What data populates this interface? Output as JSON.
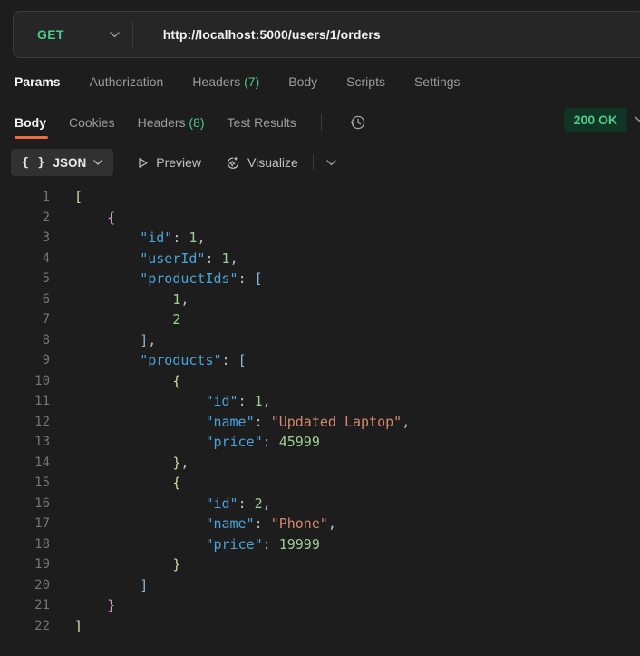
{
  "request": {
    "method": "GET",
    "url": "http://localhost:5000/users/1/orders"
  },
  "request_tabs": {
    "items": [
      {
        "label": "Params",
        "active": true
      },
      {
        "label": "Authorization"
      },
      {
        "label": "Headers",
        "count": "(7)"
      },
      {
        "label": "Body"
      },
      {
        "label": "Scripts"
      },
      {
        "label": "Settings"
      }
    ]
  },
  "response_tabs": {
    "items": [
      {
        "label": "Body",
        "active": true
      },
      {
        "label": "Cookies"
      },
      {
        "label": "Headers",
        "count": "(8)"
      },
      {
        "label": "Test Results"
      }
    ]
  },
  "status": {
    "text": "200 OK"
  },
  "toolbar": {
    "format_label": "JSON",
    "braces_glyph": "{ }",
    "preview_label": "Preview",
    "visualize_label": "Visualize"
  },
  "icons": [
    "chevron-down-icon",
    "history-clock-icon",
    "play-icon",
    "sparkle-visualize-icon",
    "braces-icon"
  ],
  "colors": {
    "accent_green": "#4dc98a",
    "tab_active_underline": "#ee6b3b",
    "status_badge_bg": "#113524",
    "key_blue": "#4aa3d9",
    "number_green": "#9ccf93",
    "string_orange": "#d8876b"
  },
  "response_body": {
    "line_count": 22,
    "lines": [
      {
        "n": 1,
        "indent": 0,
        "tokens": [
          [
            "b1",
            "["
          ]
        ]
      },
      {
        "n": 2,
        "indent": 1,
        "tokens": [
          [
            "b2",
            "{"
          ]
        ]
      },
      {
        "n": 3,
        "indent": 2,
        "tokens": [
          [
            "key",
            "\"id\""
          ],
          [
            "pun",
            ": "
          ],
          [
            "num",
            "1"
          ],
          [
            "pun",
            ","
          ]
        ]
      },
      {
        "n": 4,
        "indent": 2,
        "tokens": [
          [
            "key",
            "\"userId\""
          ],
          [
            "pun",
            ": "
          ],
          [
            "num",
            "1"
          ],
          [
            "pun",
            ","
          ]
        ]
      },
      {
        "n": 5,
        "indent": 2,
        "tokens": [
          [
            "key",
            "\"productIds\""
          ],
          [
            "pun",
            ": "
          ],
          [
            "b3",
            "["
          ]
        ]
      },
      {
        "n": 6,
        "indent": 3,
        "tokens": [
          [
            "num",
            "1"
          ],
          [
            "pun",
            ","
          ]
        ]
      },
      {
        "n": 7,
        "indent": 3,
        "tokens": [
          [
            "num",
            "2"
          ]
        ]
      },
      {
        "n": 8,
        "indent": 2,
        "tokens": [
          [
            "b3",
            "]"
          ],
          [
            "pun",
            ","
          ]
        ]
      },
      {
        "n": 9,
        "indent": 2,
        "tokens": [
          [
            "key",
            "\"products\""
          ],
          [
            "pun",
            ": "
          ],
          [
            "b3",
            "["
          ]
        ]
      },
      {
        "n": 10,
        "indent": 3,
        "tokens": [
          [
            "b4",
            "{"
          ]
        ]
      },
      {
        "n": 11,
        "indent": 4,
        "tokens": [
          [
            "key",
            "\"id\""
          ],
          [
            "pun",
            ": "
          ],
          [
            "num",
            "1"
          ],
          [
            "pun",
            ","
          ]
        ]
      },
      {
        "n": 12,
        "indent": 4,
        "tokens": [
          [
            "key",
            "\"name\""
          ],
          [
            "pun",
            ": "
          ],
          [
            "str",
            "\"Updated Laptop\""
          ],
          [
            "pun",
            ","
          ]
        ]
      },
      {
        "n": 13,
        "indent": 4,
        "tokens": [
          [
            "key",
            "\"price\""
          ],
          [
            "pun",
            ": "
          ],
          [
            "num",
            "45999"
          ]
        ]
      },
      {
        "n": 14,
        "indent": 3,
        "tokens": [
          [
            "b4",
            "}"
          ],
          [
            "pun",
            ","
          ]
        ]
      },
      {
        "n": 15,
        "indent": 3,
        "tokens": [
          [
            "b4",
            "{"
          ]
        ]
      },
      {
        "n": 16,
        "indent": 4,
        "tokens": [
          [
            "key",
            "\"id\""
          ],
          [
            "pun",
            ": "
          ],
          [
            "num",
            "2"
          ],
          [
            "pun",
            ","
          ]
        ]
      },
      {
        "n": 17,
        "indent": 4,
        "tokens": [
          [
            "key",
            "\"name\""
          ],
          [
            "pun",
            ": "
          ],
          [
            "str",
            "\"Phone\""
          ],
          [
            "pun",
            ","
          ]
        ]
      },
      {
        "n": 18,
        "indent": 4,
        "tokens": [
          [
            "key",
            "\"price\""
          ],
          [
            "pun",
            ": "
          ],
          [
            "num",
            "19999"
          ]
        ]
      },
      {
        "n": 19,
        "indent": 3,
        "tokens": [
          [
            "b4",
            "}"
          ]
        ]
      },
      {
        "n": 20,
        "indent": 2,
        "tokens": [
          [
            "b3",
            "]"
          ]
        ]
      },
      {
        "n": 21,
        "indent": 1,
        "tokens": [
          [
            "b2",
            "}"
          ]
        ]
      },
      {
        "n": 22,
        "indent": 0,
        "tokens": [
          [
            "b1",
            "]"
          ]
        ]
      }
    ]
  }
}
